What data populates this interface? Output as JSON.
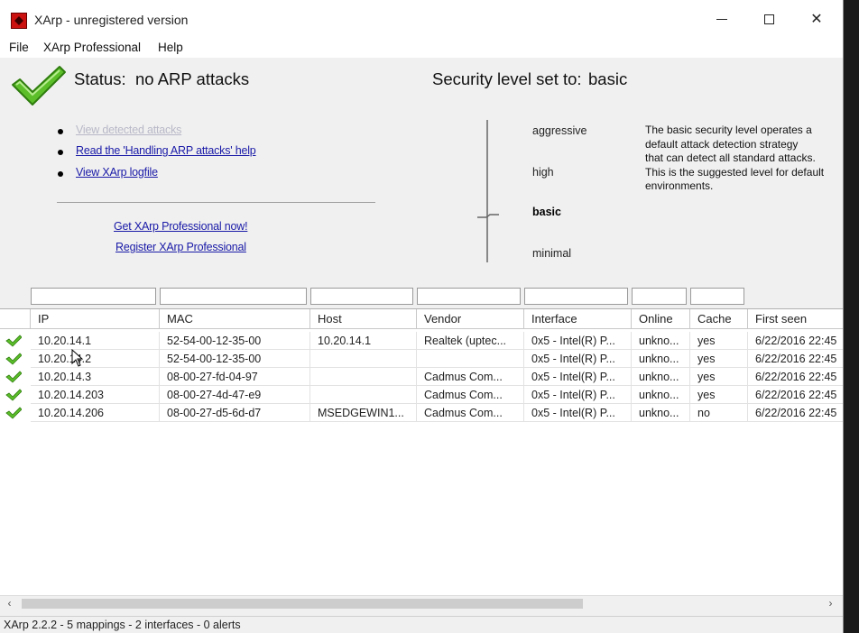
{
  "window": {
    "title": "XArp - unregistered version"
  },
  "menu": [
    "File",
    "XArp Professional",
    "Help"
  ],
  "status": {
    "label": "Status:",
    "value": "no ARP attacks"
  },
  "security": {
    "label": "Security level set to:",
    "value": "basic",
    "levels": [
      "aggressive",
      "high",
      "basic",
      "minimal"
    ],
    "active_level": "basic",
    "description_lines": [
      "The basic security level operates a",
      "default attack detection strategy",
      "that can detect all standard attacks.",
      "This is the suggested level for default",
      "environments."
    ]
  },
  "links": {
    "view_detected": "View detected attacks",
    "handling_help": "Read the 'Handling ARP attacks' help",
    "view_logfile": "View XArp logfile",
    "get_pro": "Get XArp Professional now!",
    "register_pro": "Register XArp Professional"
  },
  "table": {
    "columns": [
      "IP",
      "MAC",
      "Host",
      "Vendor",
      "Interface",
      "Online",
      "Cache",
      "First seen"
    ],
    "rows": [
      [
        "10.20.14.1",
        "52-54-00-12-35-00",
        "10.20.14.1",
        "Realtek (uptec...",
        "0x5 - Intel(R) P...",
        "unkno...",
        "yes",
        "6/22/2016 22:45"
      ],
      [
        "10.20.14.2",
        "52-54-00-12-35-00",
        "",
        "",
        "0x5 - Intel(R) P...",
        "unkno...",
        "yes",
        "6/22/2016 22:45"
      ],
      [
        "10.20.14.3",
        "08-00-27-fd-04-97",
        "",
        "Cadmus Com...",
        "0x5 - Intel(R) P...",
        "unkno...",
        "yes",
        "6/22/2016 22:45"
      ],
      [
        "10.20.14.203",
        "08-00-27-4d-47-e9",
        "",
        "Cadmus Com...",
        "0x5 - Intel(R) P...",
        "unkno...",
        "yes",
        "6/22/2016 22:45"
      ],
      [
        "10.20.14.206",
        "08-00-27-d5-6d-d7",
        "MSEDGEWIN1...",
        "Cadmus Com...",
        "0x5 - Intel(R) P...",
        "unkno...",
        "no",
        "6/22/2016 22:45"
      ]
    ]
  },
  "statusbar": "XArp 2.2.2  -  5 mappings  -  2 interfaces  -  0 alerts",
  "colors": {
    "check_green": "#4caf1a",
    "link_blue": "#1a1aa8"
  },
  "icons": {
    "status": "check-icon",
    "row_state": "check-icon"
  }
}
